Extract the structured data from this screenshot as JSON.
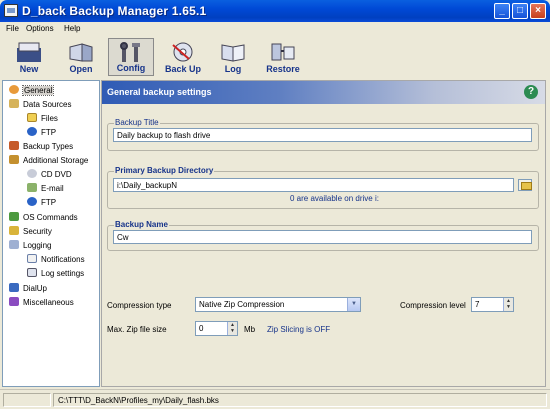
{
  "window": {
    "title": "D_back Backup Manager 1.65.1",
    "controls": {
      "minimize": "_",
      "maximize": "□",
      "close": "×"
    }
  },
  "menu": [
    "File",
    "Options",
    "Help"
  ],
  "toolbar": {
    "buttons": [
      {
        "label": "New",
        "icon": "new-document-icon"
      },
      {
        "label": "Open",
        "icon": "open-folder-icon"
      },
      {
        "label": "Config",
        "icon": "config-tools-icon",
        "active": true
      },
      {
        "label": "Back Up",
        "icon": "backup-disc-icon"
      },
      {
        "label": "Log",
        "icon": "log-book-icon"
      },
      {
        "label": "Restore",
        "icon": "restore-icon"
      }
    ]
  },
  "tree": {
    "items": [
      {
        "label": "General",
        "icon": "general-icon",
        "level": 0,
        "selected": true
      },
      {
        "label": "Data Sources",
        "icon": "data-sources-icon",
        "level": 0
      },
      {
        "label": "Files",
        "icon": "folder-icon",
        "level": 1
      },
      {
        "label": "FTP",
        "icon": "ftp-globe-icon",
        "level": 1
      },
      {
        "label": "Backup Types",
        "icon": "backup-types-icon",
        "level": 0
      },
      {
        "label": "Additional Storage",
        "icon": "storage-icon",
        "level": 0
      },
      {
        "label": "CD DVD",
        "icon": "cd-icon",
        "level": 1
      },
      {
        "label": "E-mail",
        "icon": "email-icon",
        "level": 1
      },
      {
        "label": "FTP",
        "icon": "ftp-globe-icon",
        "level": 1
      },
      {
        "label": "OS Commands",
        "icon": "os-commands-icon",
        "level": 0
      },
      {
        "label": "Security",
        "icon": "key-icon",
        "level": 0
      },
      {
        "label": "Logging",
        "icon": "logging-icon",
        "level": 0
      },
      {
        "label": "Notifications",
        "icon": "envelope-icon",
        "level": 1
      },
      {
        "label": "Log settings",
        "icon": "log-book-icon",
        "level": 1
      },
      {
        "label": "DialUp",
        "icon": "dialup-icon",
        "level": 0
      },
      {
        "label": "Miscellaneous",
        "icon": "misc-icon",
        "level": 0
      }
    ]
  },
  "panel": {
    "title": "General backup settings",
    "help": "?",
    "backup_title": {
      "label": "Backup Title",
      "value": "Daily backup to flash drive"
    },
    "primary_dir": {
      "label": "Primary Backup Directory",
      "value": "i:\\Daily_backupN",
      "note": "0 are available on drive i:"
    },
    "backup_name": {
      "label": "Backup Name",
      "value": "Cw"
    },
    "compression_type": {
      "label": "Compression type",
      "value": "Native Zip Compression"
    },
    "compression_level": {
      "label": "Compression level",
      "value": "7"
    },
    "max_zip": {
      "label": "Max. Zip file size",
      "value": "0",
      "unit": "Mb",
      "note": "Zip Slicing is OFF"
    }
  },
  "status": {
    "left": "",
    "path": "C:\\TTT\\D_BackN\\Profiles_my\\Daily_flash.bks"
  },
  "colors": {
    "titlebar": "#0049d6",
    "link_blue": "#16338a",
    "panel_header": "#2f5bb5"
  }
}
